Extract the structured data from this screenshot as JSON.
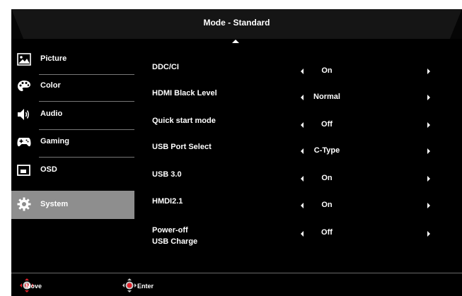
{
  "header": {
    "title": "Mode - Standard"
  },
  "sidebar": {
    "items": [
      {
        "label": "Picture",
        "icon": "picture-icon",
        "active": false
      },
      {
        "label": "Color",
        "icon": "palette-icon",
        "active": false
      },
      {
        "label": "Audio",
        "icon": "speaker-icon",
        "active": false
      },
      {
        "label": "Gaming",
        "icon": "gamepad-icon",
        "active": false
      },
      {
        "label": "OSD",
        "icon": "osd-icon",
        "active": false
      },
      {
        "label": "System",
        "icon": "gear-icon",
        "active": true
      }
    ]
  },
  "settings": {
    "rows": [
      {
        "name": "DDC/CI",
        "value": "On"
      },
      {
        "name": "HDMI Black Level",
        "value": "Normal"
      },
      {
        "name": "Quick start mode",
        "value": "Off"
      },
      {
        "name": "USB Port Select",
        "value": "C-Type"
      },
      {
        "name": "USB 3.0",
        "value": "On"
      },
      {
        "name": "HMDI2.1",
        "value": "On"
      },
      {
        "name_line1": "Power-off",
        "name_line2": "USB Charge",
        "value": "Off"
      }
    ]
  },
  "footer": {
    "move_label": "Move",
    "enter_label": "Enter"
  },
  "colors": {
    "background": "#000000",
    "active_item": "#8e8e8e",
    "nav_accent": "#e0202a",
    "text": "#ffffff"
  }
}
